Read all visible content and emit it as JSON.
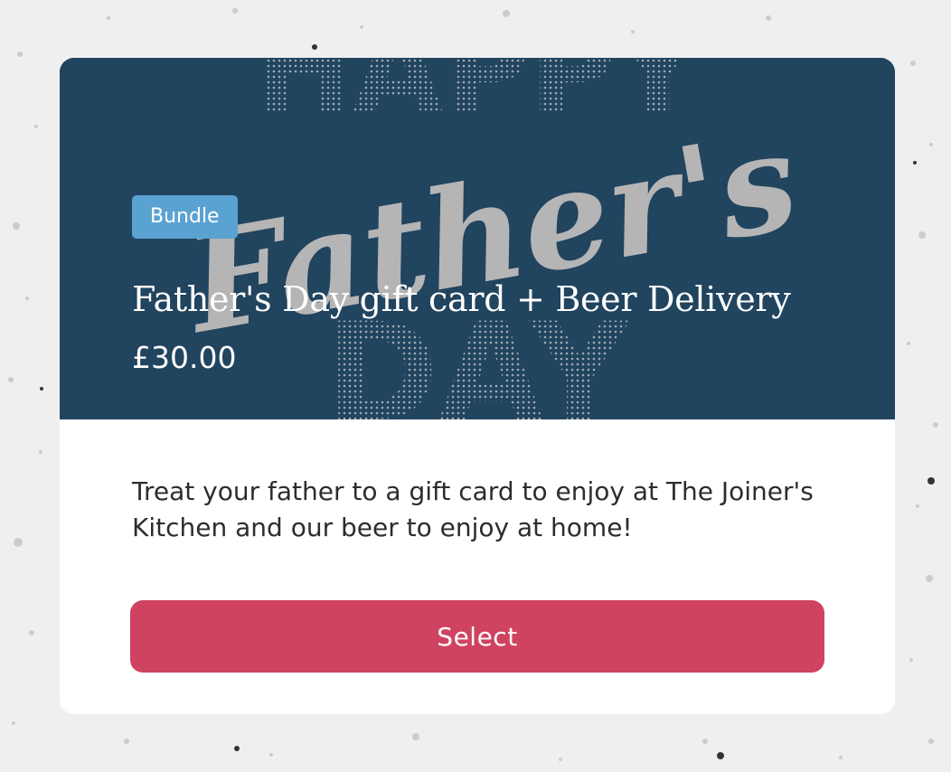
{
  "colors": {
    "hero_background": "#21445f",
    "badge_background": "#5aa2d1",
    "button_background": "#cf4360",
    "card_background": "#ffffff",
    "page_background": "#eeeeee"
  },
  "product": {
    "badge": "Bundle",
    "title": "Father's Day gift card + Beer Delivery",
    "price": "£30.00",
    "description": "Treat your father to a gift card to enjoy at The Joiner's Kitchen and our beer to enjoy at home!",
    "image": {
      "lettering_top": "HAPPY",
      "lettering_script": "Father's",
      "lettering_bottom": "DAY"
    }
  },
  "actions": {
    "select_label": "Select"
  }
}
